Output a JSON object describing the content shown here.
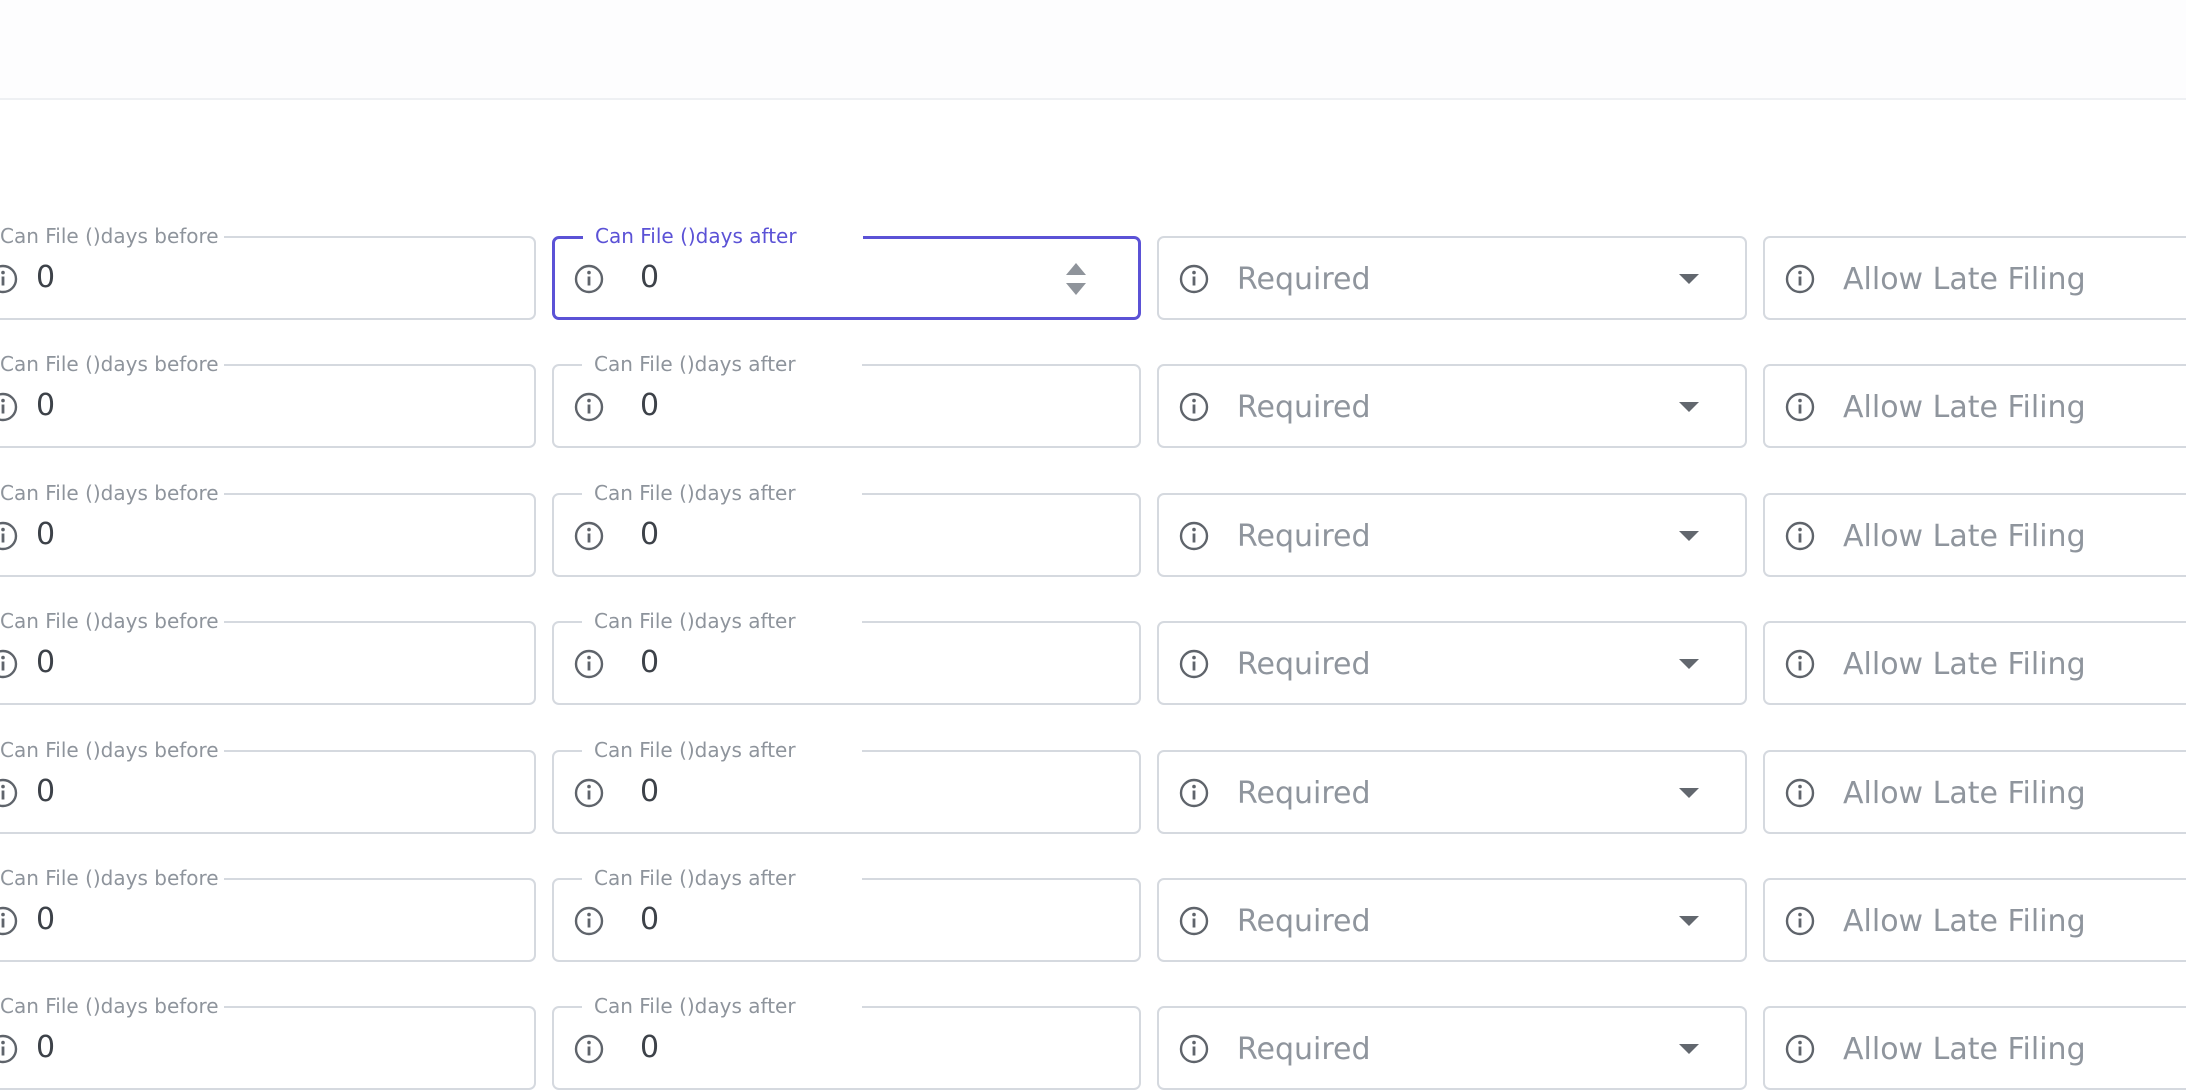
{
  "colors": {
    "focus_accent": "#5b52d6",
    "border": "#d5d9df",
    "label_text": "#8e949c",
    "value_text": "#3d4249"
  },
  "icons": {
    "info": "info-circle-icon",
    "dropdown": "chevron-down-icon",
    "stepper": "number-stepper-icon"
  },
  "rows": [
    {
      "before_label": "Can File ()days before",
      "before_value": "0",
      "after_label": "Can File ()days after",
      "after_value": "0",
      "required_placeholder": "Required",
      "late_placeholder": "Allow Late Filing"
    },
    {
      "before_label": "Can File ()days before",
      "before_value": "0",
      "after_label": "Can File ()days after",
      "after_value": "0",
      "required_placeholder": "Required",
      "late_placeholder": "Allow Late Filing"
    },
    {
      "before_label": "Can File ()days before",
      "before_value": "0",
      "after_label": "Can File ()days after",
      "after_value": "0",
      "required_placeholder": "Required",
      "late_placeholder": "Allow Late Filing"
    },
    {
      "before_label": "Can File ()days before",
      "before_value": "0",
      "after_label": "Can File ()days after",
      "after_value": "0",
      "required_placeholder": "Required",
      "late_placeholder": "Allow Late Filing"
    },
    {
      "before_label": "Can File ()days before",
      "before_value": "0",
      "after_label": "Can File ()days after",
      "after_value": "0",
      "required_placeholder": "Required",
      "late_placeholder": "Allow Late Filing"
    },
    {
      "before_label": "Can File ()days before",
      "before_value": "0",
      "after_label": "Can File ()days after",
      "after_value": "0",
      "required_placeholder": "Required",
      "late_placeholder": "Allow Late Filing"
    },
    {
      "before_label": "Can File ()days before",
      "before_value": "0",
      "after_label": "Can File ()days after",
      "after_value": "0",
      "required_placeholder": "Required",
      "late_placeholder": "Allow Late Filing"
    }
  ]
}
